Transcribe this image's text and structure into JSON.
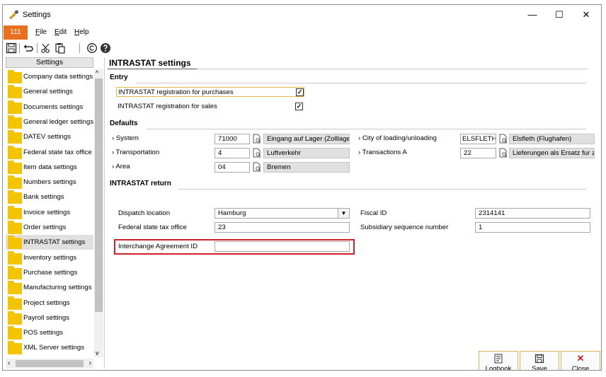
{
  "window": {
    "title": "Settings",
    "minimize_glyph": "—",
    "maximize_glyph": "☐",
    "close_glyph": "✕"
  },
  "menubar": {
    "badge": "111",
    "items": [
      {
        "accel": "F",
        "rest": "ile"
      },
      {
        "accel": "E",
        "rest": "dit"
      },
      {
        "accel": "H",
        "rest": "elp"
      }
    ]
  },
  "sidebar": {
    "header": "Settings",
    "items": [
      "Company data settings",
      "General settings",
      "Documents settings",
      "General ledger settings",
      "DATEV settings",
      "Federal state tax office",
      "Item data settings",
      "Numbers settings",
      "Bank settings",
      "Invoice settings",
      "Order settings",
      "INTRASTAT settings",
      "Inventory settings",
      "Purchase settings",
      "Manufacturing settings",
      "Project settings",
      "Payroll settings",
      "POS settings",
      "XML Server settings"
    ],
    "selected_index": 11
  },
  "main": {
    "title": "INTRASTAT settings",
    "entry": {
      "title": "Entry",
      "purchases_label": "INTRASTAT registration for purchases",
      "sales_label": "INTRASTAT registration for sales",
      "check_glyph": "✓"
    },
    "defaults": {
      "title": "Defaults",
      "system_label": "› System",
      "system_code": "71000",
      "system_desc": "Eingang auf Lager (Zolllager,",
      "transportation_label": "› Transportation",
      "transportation_code": "4",
      "transportation_desc": "Luftverkehr",
      "area_label": "› Area",
      "area_code": "04",
      "area_desc": "Bremen",
      "city_label": "› City of loading/unloading",
      "city_code": "ELSFLETHF",
      "city_desc": "Elsfleth (Flughafen)",
      "transactions_label": "› Transactions A",
      "transactions_code": "22",
      "transactions_desc": "Lieferungen als Ersatz fur zu"
    },
    "return": {
      "title": "INTRASTAT return",
      "dispatch_label": "Dispatch location",
      "dispatch_value": "Hamburg",
      "tax_office_label": "Federal state tax office",
      "tax_office_value": "23",
      "interchange_label": "Interchange Agreement ID",
      "interchange_value": "",
      "fiscal_label": "Fiscal ID",
      "fiscal_value": "2314141",
      "subsidiary_label": "Subsidiary sequence number",
      "subsidiary_value": "1"
    }
  },
  "buttons": {
    "logbook": "Logbook",
    "save": "Save",
    "close": "Close"
  },
  "colors": {
    "accent_orange": "#e8701f",
    "folder_yellow": "#f5c400",
    "highlight_red": "#d0202a"
  }
}
